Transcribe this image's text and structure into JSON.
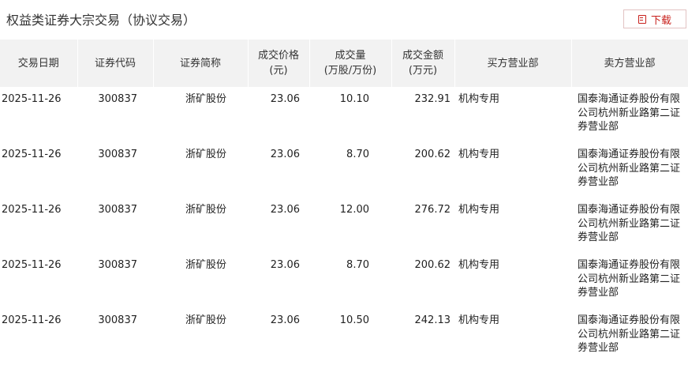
{
  "header": {
    "title": "权益类证券大宗交易（协议交易）",
    "download_label": "下载"
  },
  "table": {
    "columns": [
      {
        "line1": "交易日期",
        "line2": ""
      },
      {
        "line1": "证券代码",
        "line2": ""
      },
      {
        "line1": "证券简称",
        "line2": ""
      },
      {
        "line1": "成交价格",
        "line2": "(元)"
      },
      {
        "line1": "成交量",
        "line2": "(万股/万份)"
      },
      {
        "line1": "成交金额",
        "line2": "(万元)"
      },
      {
        "line1": "买方营业部",
        "line2": ""
      },
      {
        "line1": "卖方营业部",
        "line2": ""
      }
    ],
    "rows": [
      {
        "date": "2025-11-26",
        "code": "300837",
        "name": "浙矿股份",
        "price": "23.06",
        "volume": "10.10",
        "amount": "232.91",
        "buyer": "机构专用",
        "seller": "国泰海通证券股份有限公司杭州新业路第二证券营业部"
      },
      {
        "date": "2025-11-26",
        "code": "300837",
        "name": "浙矿股份",
        "price": "23.06",
        "volume": "8.70",
        "amount": "200.62",
        "buyer": "机构专用",
        "seller": "国泰海通证券股份有限公司杭州新业路第二证券营业部"
      },
      {
        "date": "2025-11-26",
        "code": "300837",
        "name": "浙矿股份",
        "price": "23.06",
        "volume": "12.00",
        "amount": "276.72",
        "buyer": "机构专用",
        "seller": "国泰海通证券股份有限公司杭州新业路第二证券营业部"
      },
      {
        "date": "2025-11-26",
        "code": "300837",
        "name": "浙矿股份",
        "price": "23.06",
        "volume": "8.70",
        "amount": "200.62",
        "buyer": "机构专用",
        "seller": "国泰海通证券股份有限公司杭州新业路第二证券营业部"
      },
      {
        "date": "2025-11-26",
        "code": "300837",
        "name": "浙矿股份",
        "price": "23.06",
        "volume": "10.50",
        "amount": "242.13",
        "buyer": "机构专用",
        "seller": "国泰海通证券股份有限公司杭州新业路第二证券营业部"
      }
    ]
  }
}
